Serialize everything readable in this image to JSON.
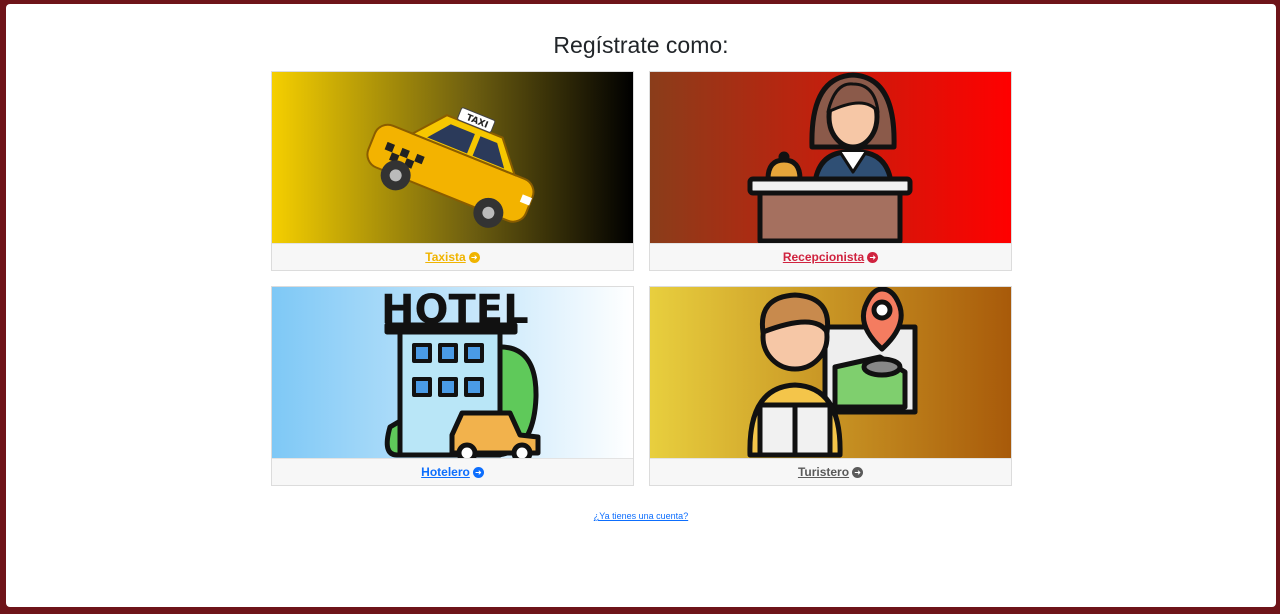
{
  "page": {
    "title": "Regístrate como:"
  },
  "cards": [
    {
      "label": "Taxista",
      "color": "#f0b400",
      "icon": "taxi-icon"
    },
    {
      "label": "Recepcionista",
      "color": "#d0233f",
      "icon": "receptionist-icon"
    },
    {
      "label": "Hotelero",
      "color": "#0d6efd",
      "icon": "hotel-icon"
    },
    {
      "label": "Turistero",
      "color": "#5a5a5a",
      "icon": "tourist-guide-icon"
    }
  ],
  "hotel_sign": "HOTEL",
  "taxi_sign": "TAXI",
  "footer": {
    "login_link": "¿Ya tienes una cuenta?"
  },
  "colors": {
    "frame": "#6e1419",
    "panel": "#ffffff"
  }
}
